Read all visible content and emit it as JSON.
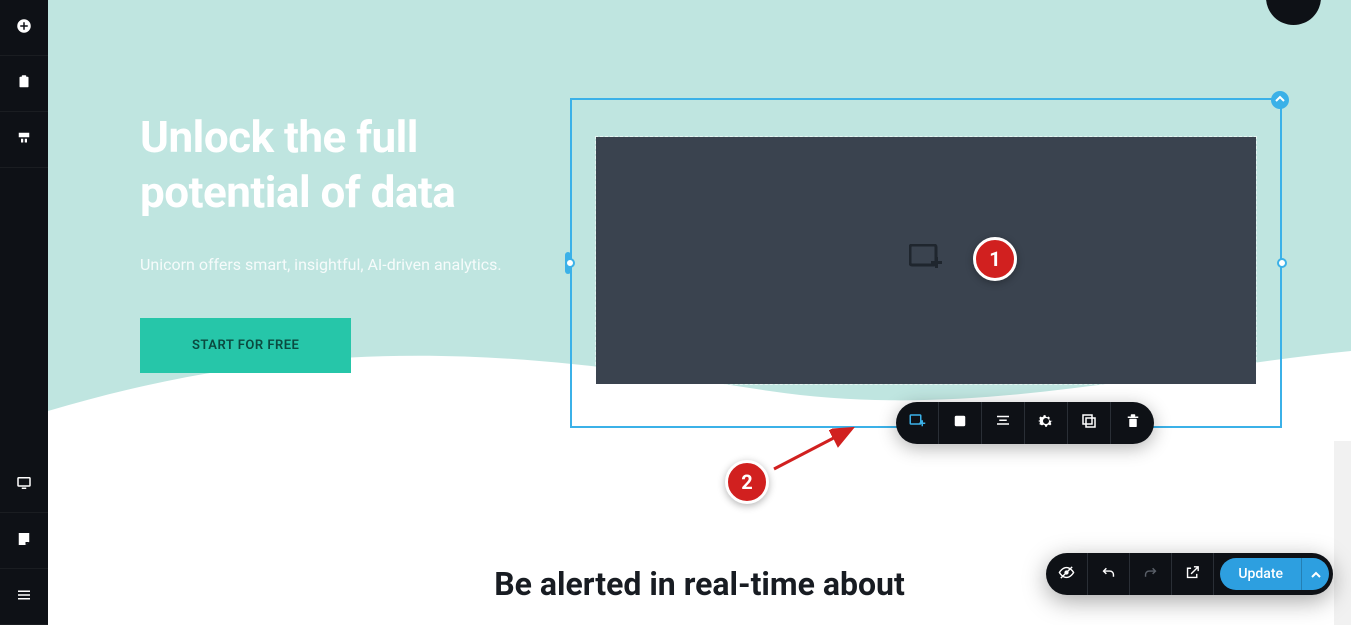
{
  "hero": {
    "title": "Unlock the full potential of data",
    "subtitle": "Unicorn offers smart, insightful, AI-driven analytics.",
    "cta_label": "START FOR FREE"
  },
  "section2": {
    "heading": "Be alerted in real-time about"
  },
  "context_toolbar": {
    "items": [
      {
        "name": "add-image-icon"
      },
      {
        "name": "square-icon"
      },
      {
        "name": "align-icon"
      },
      {
        "name": "settings-icon"
      },
      {
        "name": "duplicate-icon"
      },
      {
        "name": "delete-icon"
      }
    ]
  },
  "annotations": {
    "marker1": "1",
    "marker2": "2"
  },
  "action_bar": {
    "update_label": "Update"
  },
  "left_rail": {
    "top": [
      "plus-circle-icon",
      "clipboard-icon",
      "sections-icon"
    ],
    "bottom": [
      "desktop-icon",
      "note-icon",
      "menu-icon"
    ]
  }
}
